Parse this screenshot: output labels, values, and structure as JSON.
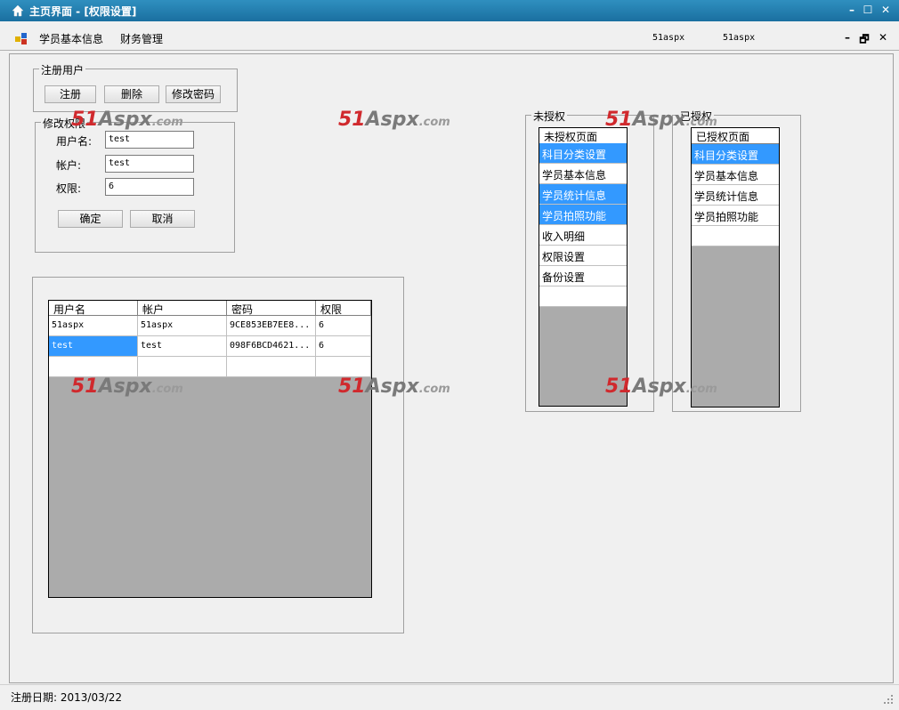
{
  "window": {
    "title": "主页界面 - [权限设置]",
    "minimize": "–",
    "maximize": "☐",
    "close": "✕"
  },
  "menubar": {
    "items": [
      "学员基本信息",
      "财务管理"
    ],
    "right_items": [
      "51aspx",
      "51aspx"
    ],
    "mdi_min": "–",
    "mdi_restore": "🗗",
    "mdi_close": "✕"
  },
  "register_group": {
    "legend": "注册用户",
    "register_label": "注册",
    "delete_label": "删除",
    "change_pwd_label": "修改密码"
  },
  "modify_group": {
    "legend": "修改权限",
    "username_label": "用户名:",
    "username_value": "test",
    "account_label": "帐户:",
    "account_value": "test",
    "permission_label": "权限:",
    "permission_value": "6",
    "ok_label": "确定",
    "cancel_label": "取消"
  },
  "users_grid": {
    "columns": [
      "用户名",
      "帐户",
      "密码",
      "权限"
    ],
    "rows": [
      [
        "51aspx",
        "51aspx",
        "9CE853EB7EE8...",
        "6"
      ],
      [
        "test",
        "test",
        "098F6BCD4621...",
        "6"
      ],
      [
        "",
        "",
        "",
        ""
      ]
    ],
    "selected_row": 1
  },
  "unauthorized_group": {
    "legend": "未授权",
    "header": "未授权页面",
    "items": [
      "科目分类设置",
      "学员基本信息",
      "学员统计信息",
      "学员拍照功能",
      "收入明细",
      "权限设置",
      "备份设置",
      ""
    ],
    "selected": [
      0,
      2,
      3
    ]
  },
  "authorized_group": {
    "legend": "已授权",
    "header": "已授权页面",
    "items": [
      "科目分类设置",
      "学员基本信息",
      "学员统计信息",
      "学员拍照功能",
      ""
    ],
    "selected": [
      0
    ]
  },
  "watermark": {
    "num": "51",
    "brand": "Aspx",
    "tld": ".com"
  },
  "status": {
    "text": "注册日期:  2013/03/22"
  },
  "colors": {
    "selection": "#3399ff",
    "titlebar": "#1a6fa0",
    "empty_area": "#ababab"
  }
}
